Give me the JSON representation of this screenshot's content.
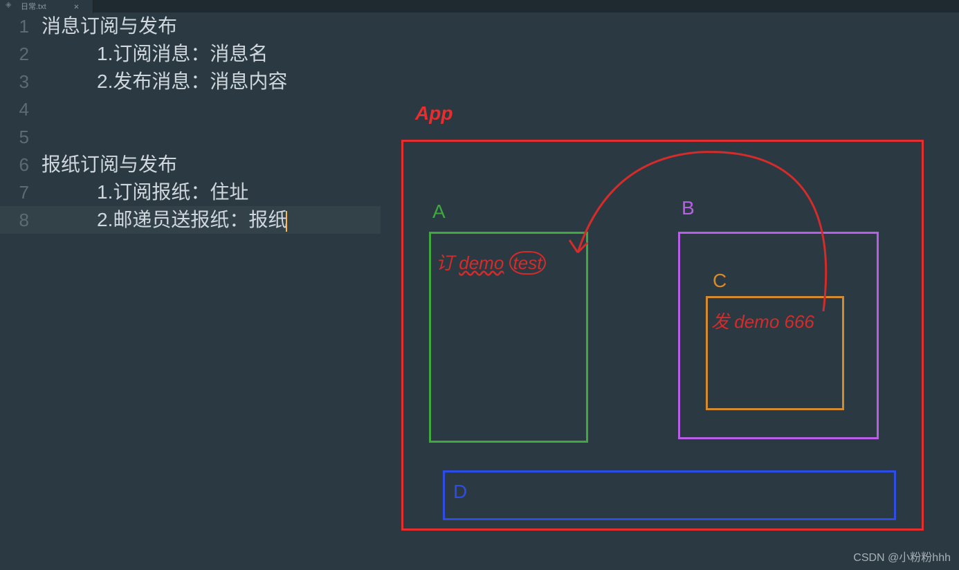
{
  "tab": {
    "filename": "日常.txt",
    "close": "×"
  },
  "gutter": [
    "1",
    "2",
    "3",
    "4",
    "5",
    "6",
    "7",
    "8"
  ],
  "code": {
    "l1": "消息订阅与发布",
    "l2": "1.订阅消息：消息名",
    "l3": "2.发布消息：消息内容",
    "l4": "",
    "l5": "",
    "l6": "报纸订阅与发布",
    "l7": "1.订阅报纸：住址",
    "l8": "2.邮递员送报纸：报纸"
  },
  "diagram": {
    "app": "App",
    "a": "A",
    "b": "B",
    "c": "C",
    "d": "D",
    "hand_a_char": "订",
    "hand_a_demo": "demo",
    "hand_a_test": "test",
    "hand_c_char": "发",
    "hand_c_text": "demo 666"
  },
  "watermark": "CSDN @小粉粉hhh"
}
